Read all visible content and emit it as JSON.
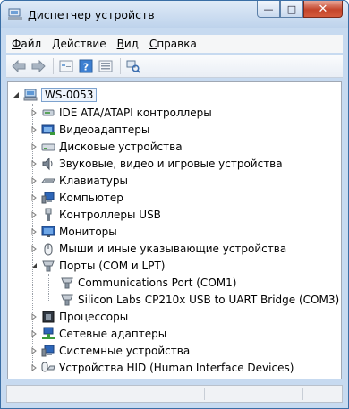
{
  "window": {
    "title": "Диспетчер устройств",
    "minimize_glyph": "—",
    "maximize_glyph": "□",
    "close_glyph": "✕"
  },
  "menu": [
    {
      "underline": "Ф",
      "rest": "айл"
    },
    {
      "underline": "Д",
      "rest": "ействие"
    },
    {
      "underline": "В",
      "rest": "ид"
    },
    {
      "underline": "С",
      "rest": "правка"
    }
  ],
  "toolbar": {
    "buttons": [
      "back-icon",
      "forward-icon",
      "properties-view-icon",
      "help-icon",
      "details-view-icon",
      "scan-hardware-icon"
    ]
  },
  "tree": {
    "root": {
      "label": "WS-0053",
      "expanded": true
    },
    "categories": [
      {
        "label": "IDE ATA/ATAPI контроллеры",
        "icon": "ide-controller-icon",
        "expanded": false
      },
      {
        "label": "Видеоадаптеры",
        "icon": "display-adapter-icon",
        "expanded": false
      },
      {
        "label": "Дисковые устройства",
        "icon": "disk-drive-icon",
        "expanded": false
      },
      {
        "label": "Звуковые, видео и игровые устройства",
        "icon": "sound-icon",
        "expanded": false
      },
      {
        "label": "Клавиатуры",
        "icon": "keyboard-icon",
        "expanded": false
      },
      {
        "label": "Компьютер",
        "icon": "computer-icon",
        "expanded": false
      },
      {
        "label": "Контроллеры USB",
        "icon": "usb-icon",
        "expanded": false
      },
      {
        "label": "Мониторы",
        "icon": "monitor-icon",
        "expanded": false
      },
      {
        "label": "Мыши и иные указывающие устройства",
        "icon": "mouse-icon",
        "expanded": false
      },
      {
        "label": "Порты (COM и LPT)",
        "icon": "port-icon",
        "expanded": true,
        "children": [
          {
            "label": "Communications Port (COM1)",
            "icon": "port-icon"
          },
          {
            "label": "Silicon Labs CP210x USB to UART Bridge (COM3)",
            "icon": "port-icon"
          }
        ]
      },
      {
        "label": "Процессоры",
        "icon": "processor-icon",
        "expanded": false
      },
      {
        "label": "Сетевые адаптеры",
        "icon": "network-adapter-icon",
        "expanded": false
      },
      {
        "label": "Системные устройства",
        "icon": "system-device-icon",
        "expanded": false
      },
      {
        "label": "Устройства HID (Human Interface Devices)",
        "icon": "hid-icon",
        "expanded": false
      }
    ]
  },
  "colors": {
    "title_gradient_top": "#dfeaf7",
    "title_gradient_bottom": "#bed3ec",
    "close_button": "#c4452b",
    "selection_border": "#7da2ce"
  }
}
